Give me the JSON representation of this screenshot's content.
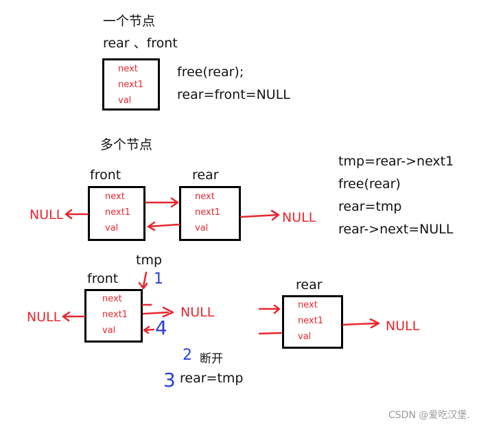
{
  "section1": {
    "title": "一个节点",
    "subtitle": "rear 、front",
    "node": {
      "fields": [
        "next",
        "next1",
        "val"
      ]
    },
    "code": [
      "free(rear);",
      "rear=front=NULL"
    ]
  },
  "section2": {
    "title": "多个节点",
    "front_label": "front",
    "rear_label": "rear",
    "front_node": {
      "fields": [
        "next",
        "next1",
        "val"
      ]
    },
    "rear_node": {
      "fields": [
        "next",
        "next1",
        "val"
      ]
    },
    "null_left": "NULL",
    "null_right": "NULL",
    "code": [
      "tmp=rear->next1",
      "free(rear)",
      "rear=tmp",
      "rear->next=NULL"
    ]
  },
  "section3": {
    "tmp_label": "tmp",
    "front_label": "front",
    "rear_label": "rear",
    "front_node": {
      "fields": [
        "next",
        "next1",
        "val"
      ]
    },
    "rear_node": {
      "fields": [
        "next",
        "next1",
        "val"
      ]
    },
    "null_left": "NULL",
    "null_mid": "NULL",
    "null_right": "NULL",
    "step1": "1",
    "step2": "2",
    "step2_text": "断开",
    "step3": "3",
    "step3_text": "rear=tmp",
    "step4": "4"
  },
  "colors": {
    "pointer": "#e8262e",
    "annotation": "#2b3ed6",
    "node_border": "#000000"
  },
  "watermark": "CSDN @爱吃汉堡."
}
